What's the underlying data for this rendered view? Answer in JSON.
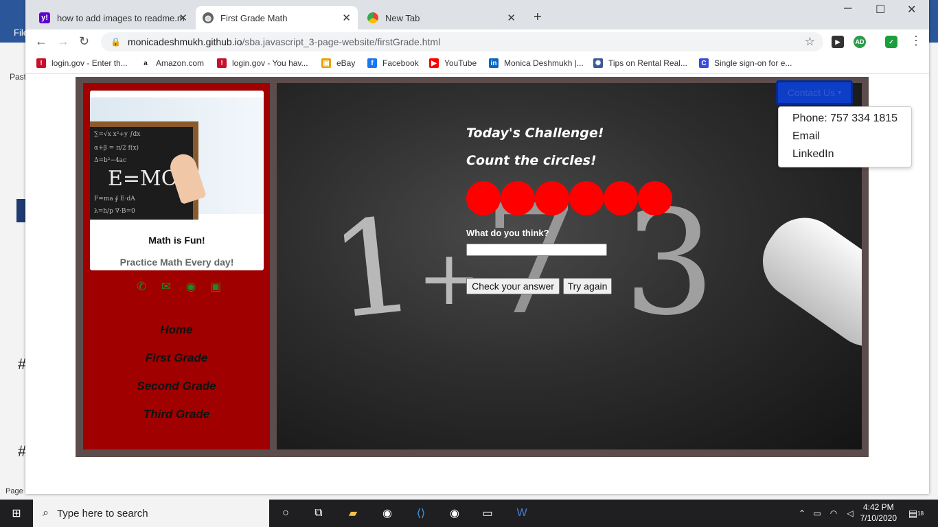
{
  "background_app": {
    "file_label": "File",
    "paste_label": "Past",
    "heading_marks": [
      "#",
      "#"
    ],
    "page_label": "Page"
  },
  "browser": {
    "tabs": [
      {
        "title": "how to add images to readme.m",
        "favicon": "yahoo-icon",
        "active": false
      },
      {
        "title": "First Grade Math",
        "favicon": "globe-icon",
        "active": true
      },
      {
        "title": "New Tab",
        "favicon": "chrome-icon",
        "active": false
      }
    ],
    "new_tab_label": "+",
    "url_host": "monicadeshmukh.github.io",
    "url_path": "/sba.javascript_3-page-website/firstGrade.html",
    "bookmarks": [
      {
        "label": "login.gov - Enter th...",
        "icon": "shield-icon",
        "color": "#c8102e"
      },
      {
        "label": "Amazon.com",
        "icon": "amazon-icon",
        "color": "#222222"
      },
      {
        "label": "login.gov - You hav...",
        "icon": "shield-icon",
        "color": "#c8102e"
      },
      {
        "label": "eBay",
        "icon": "ebay-bag-icon",
        "color": "#e8a200"
      },
      {
        "label": "Facebook",
        "icon": "facebook-icon",
        "color": "#1877f2"
      },
      {
        "label": "YouTube",
        "icon": "youtube-icon",
        "color": "#ff0000"
      },
      {
        "label": "Monica Deshmukh |...",
        "icon": "linkedin-icon",
        "color": "#0a66c2"
      },
      {
        "label": "Tips on Rental Real...",
        "icon": "globe-icon",
        "color": "#3a5a9a"
      },
      {
        "label": "Single sign-on for e...",
        "icon": "c-logo-icon",
        "color": "#3b4bd8"
      }
    ]
  },
  "page": {
    "card_title": "Math is Fun!",
    "card_subtitle": "Practice Math Every day!",
    "image_text": "E=MC",
    "social_icons": [
      "phone-icon",
      "envelope-icon",
      "github-icon",
      "linkedin-icon"
    ],
    "nav": [
      "Home",
      "First Grade",
      "Second Grade",
      "Third Grade"
    ],
    "challenge_title": "Today's Challenge!",
    "challenge_prompt": "Count the circles!",
    "circle_count": 6,
    "circle_color": "#ff0000",
    "question_label": "What do you think?",
    "answer_value": "",
    "check_button": "Check your answer",
    "retry_button": "Try again",
    "contact_button": "Contact Us",
    "contact_menu": [
      "Phone: 757 334 1815",
      "Email",
      "LinkedIn"
    ]
  },
  "taskbar": {
    "search_placeholder": "Type here to search",
    "time": "4:42 PM",
    "date": "7/10/2020",
    "notification_count": "18"
  }
}
